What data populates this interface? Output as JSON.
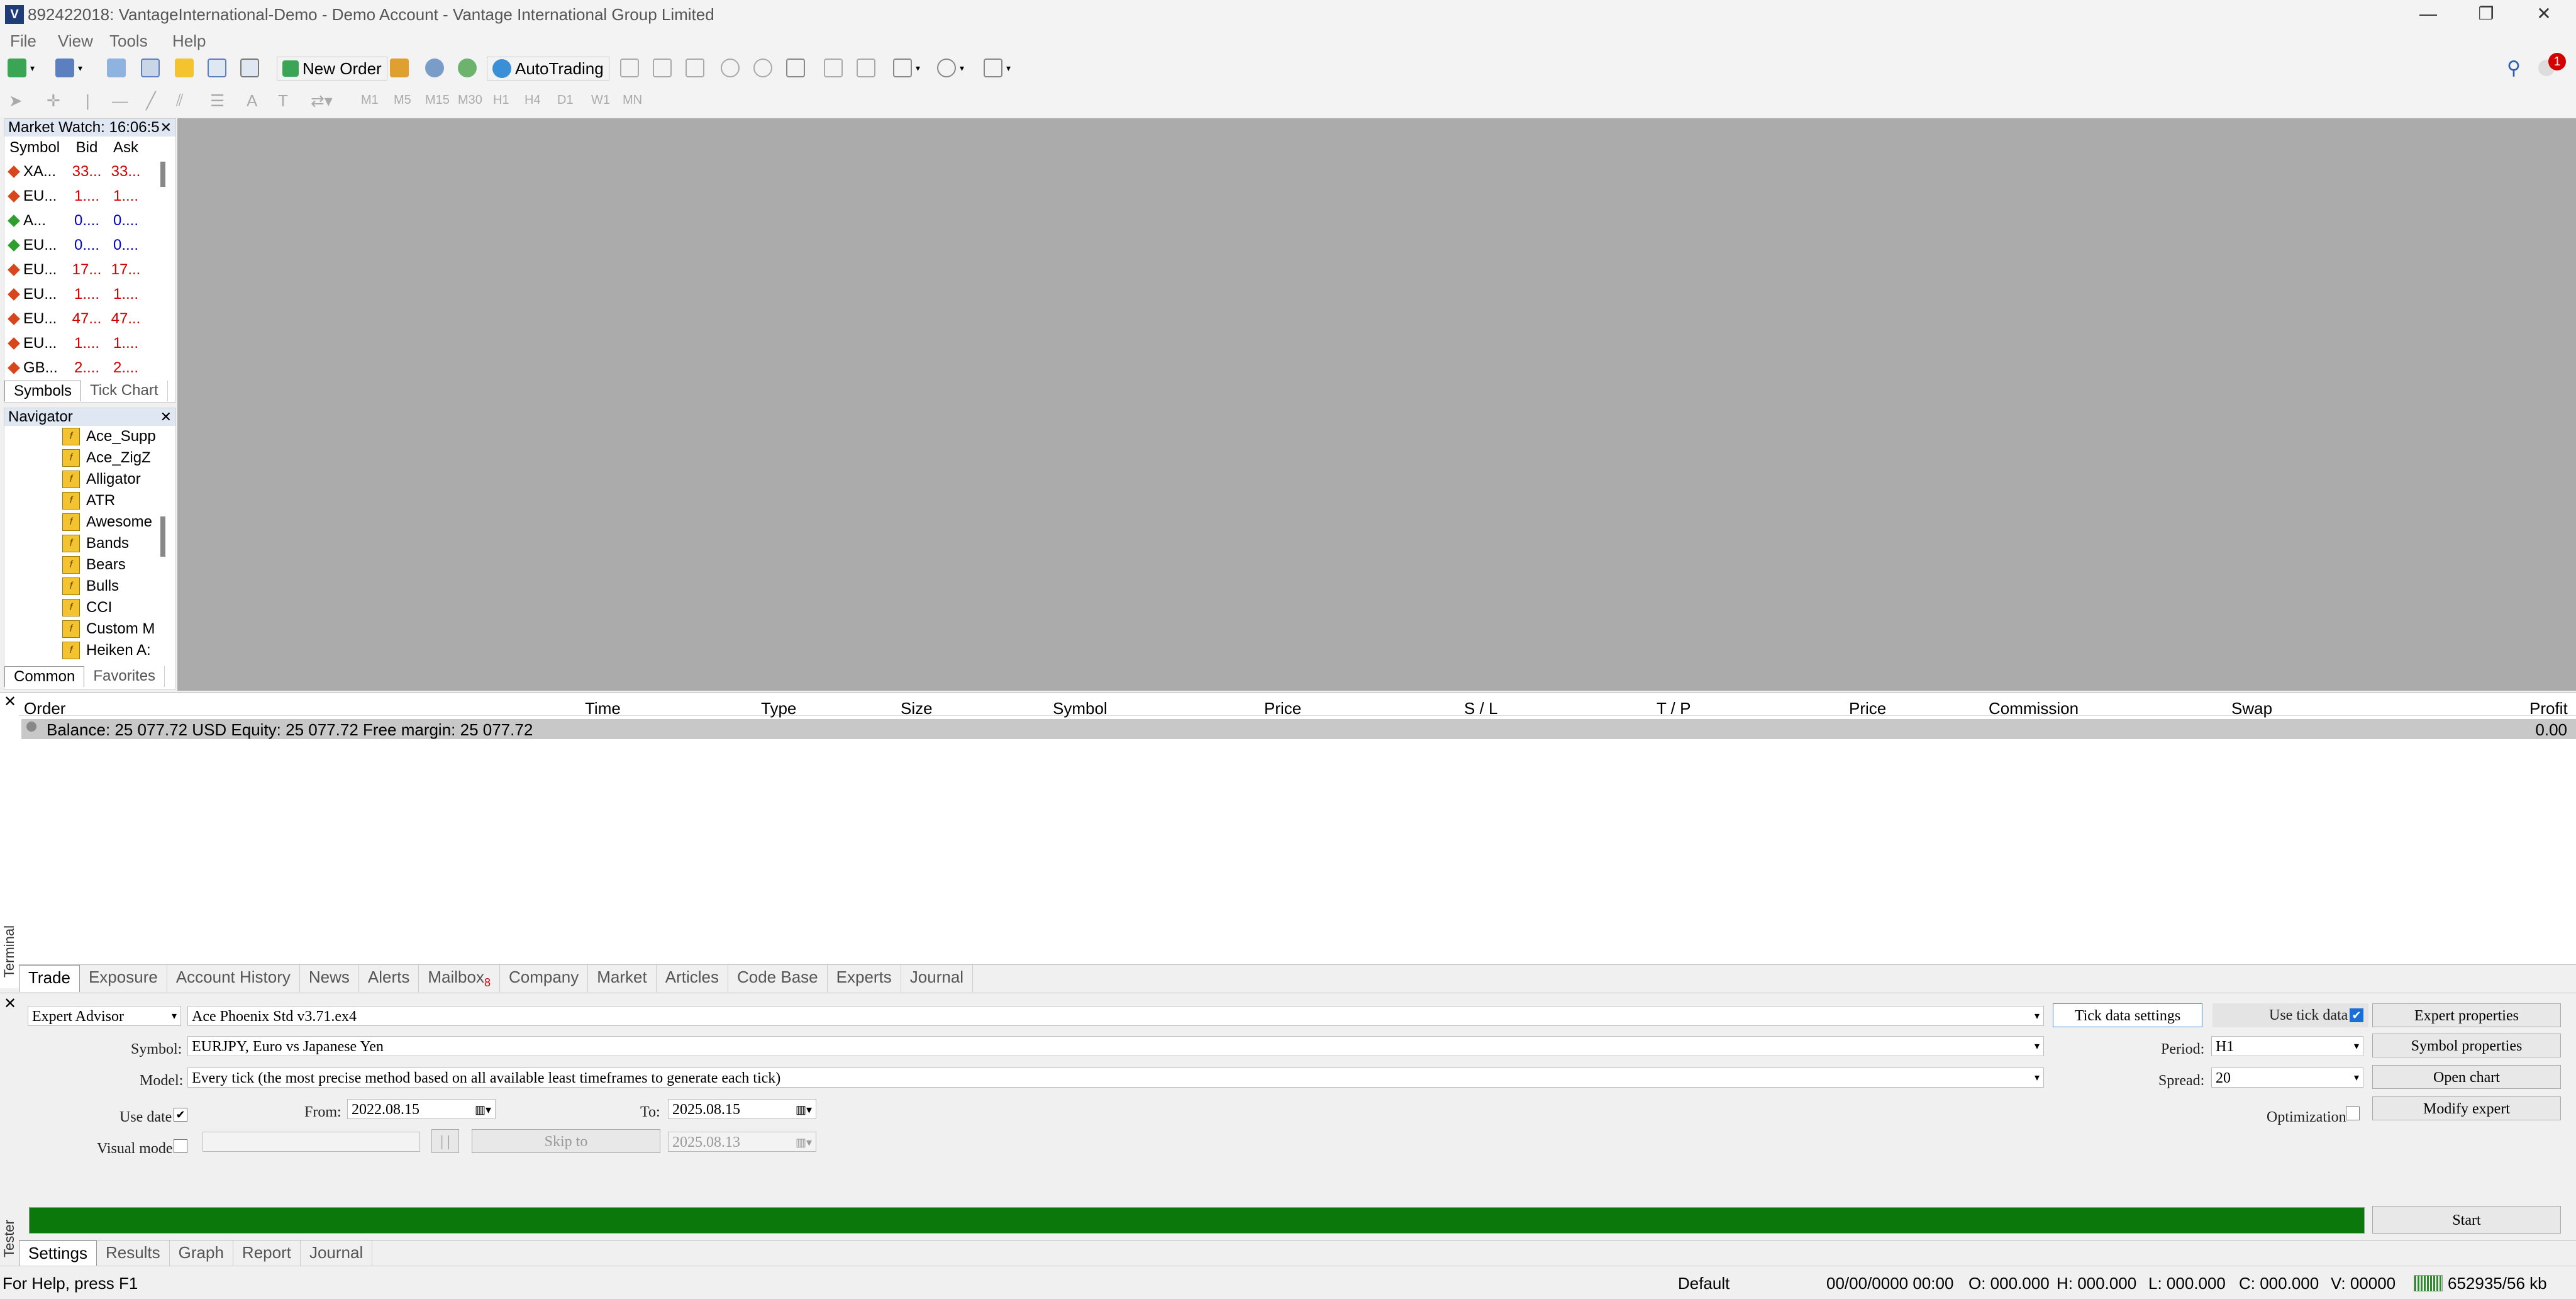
{
  "window": {
    "title": "892422018: VantageInternational-Demo - Demo Account - Vantage International Group Limited",
    "logo": "V",
    "min_glyph": "—",
    "max_glyph": "❐",
    "close_glyph": "✕"
  },
  "menu": [
    "File",
    "View",
    "Tools",
    "Help"
  ],
  "toolbar": {
    "new_order": "New Order",
    "autotrading": "AutoTrading",
    "timeframes": [
      "M1",
      "M5",
      "M15",
      "M30",
      "H1",
      "H4",
      "D1",
      "W1",
      "MN"
    ],
    "notification_count": "1"
  },
  "market_watch": {
    "title": "Market Watch: 16:06:5",
    "headers": [
      "Symbol",
      "Bid",
      "Ask"
    ],
    "rows": [
      {
        "symbol": "XA...",
        "bid": "33...",
        "ask": "33...",
        "color": "red"
      },
      {
        "symbol": "EU...",
        "bid": "1....",
        "ask": "1....",
        "color": "red"
      },
      {
        "symbol": "A...",
        "bid": "0....",
        "ask": "0....",
        "color": "blue"
      },
      {
        "symbol": "EU...",
        "bid": "0....",
        "ask": "0....",
        "color": "blue"
      },
      {
        "symbol": "EU...",
        "bid": "17...",
        "ask": "17...",
        "color": "red"
      },
      {
        "symbol": "EU...",
        "bid": "1....",
        "ask": "1....",
        "color": "red"
      },
      {
        "symbol": "EU...",
        "bid": "47...",
        "ask": "47...",
        "color": "red"
      },
      {
        "symbol": "EU...",
        "bid": "1....",
        "ask": "1....",
        "color": "red"
      },
      {
        "symbol": "GB...",
        "bid": "2....",
        "ask": "2....",
        "color": "red"
      }
    ],
    "tabs": [
      "Symbols",
      "Tick Chart"
    ]
  },
  "navigator": {
    "title": "Navigator",
    "items": [
      "Ace_Supp",
      "Ace_ZigZ",
      "Alligator",
      "ATR",
      "Awesome",
      "Bands",
      "Bears",
      "Bulls",
      "CCI",
      "Custom M",
      "Heiken A:"
    ],
    "tabs": [
      "Common",
      "Favorites"
    ]
  },
  "terminal": {
    "side_label": "Terminal",
    "headers": [
      "Order",
      "Time",
      "Type",
      "Size",
      "Symbol",
      "Price",
      "S / L",
      "T / P",
      "Price",
      "Commission",
      "Swap",
      "Profit"
    ],
    "balance_text": "Balance: 25 077.72 USD  Equity: 25 077.72  Free margin: 25 077.72",
    "profit": "0.00",
    "tabs": [
      "Trade",
      "Exposure",
      "Account History",
      "News",
      "Alerts",
      "Mailbox",
      "Company",
      "Market",
      "Articles",
      "Code Base",
      "Experts",
      "Journal"
    ],
    "mailbox_count": "8"
  },
  "tester": {
    "side_label": "Tester",
    "type": "Expert Advisor",
    "expert": "Ace Phoenix Std v3.71.ex4",
    "symbol_label": "Symbol:",
    "symbol_value": "EURJPY, Euro vs Japanese Yen",
    "model_label": "Model:",
    "model_value": "Every tick (the most precise method based on all available least timeframes to generate each tick)",
    "use_date_label": "Use date",
    "from_label": "From:",
    "from_value": "2022.08.15",
    "to_label": "To:",
    "to_value": "2025.08.15",
    "visual_mode_label": "Visual mode",
    "pause_label": "| |",
    "skip_to_label": "Skip to",
    "skip_date": "2025.08.13",
    "tick_data_settings": "Tick data settings",
    "use_tick_data": "Use tick data",
    "period_label": "Period:",
    "period_value": "H1",
    "spread_label": "Spread:",
    "spread_value": "20",
    "optimization_label": "Optimization",
    "buttons": [
      "Expert properties",
      "Symbol properties",
      "Open chart",
      "Modify expert"
    ],
    "start": "Start",
    "progress": 1.0,
    "progress_color": "#0a780a",
    "tabs": [
      "Settings",
      "Results",
      "Graph",
      "Report",
      "Journal"
    ]
  },
  "statusbar": {
    "help": "For Help, press F1",
    "profile": "Default",
    "datetime": "00/00/0000 00:00",
    "open": "O: 000.000",
    "high": "H: 000.000",
    "low": "L: 000.000",
    "close": "C: 000.000",
    "volume": "V: 00000",
    "traffic": "652935/56 kb"
  }
}
